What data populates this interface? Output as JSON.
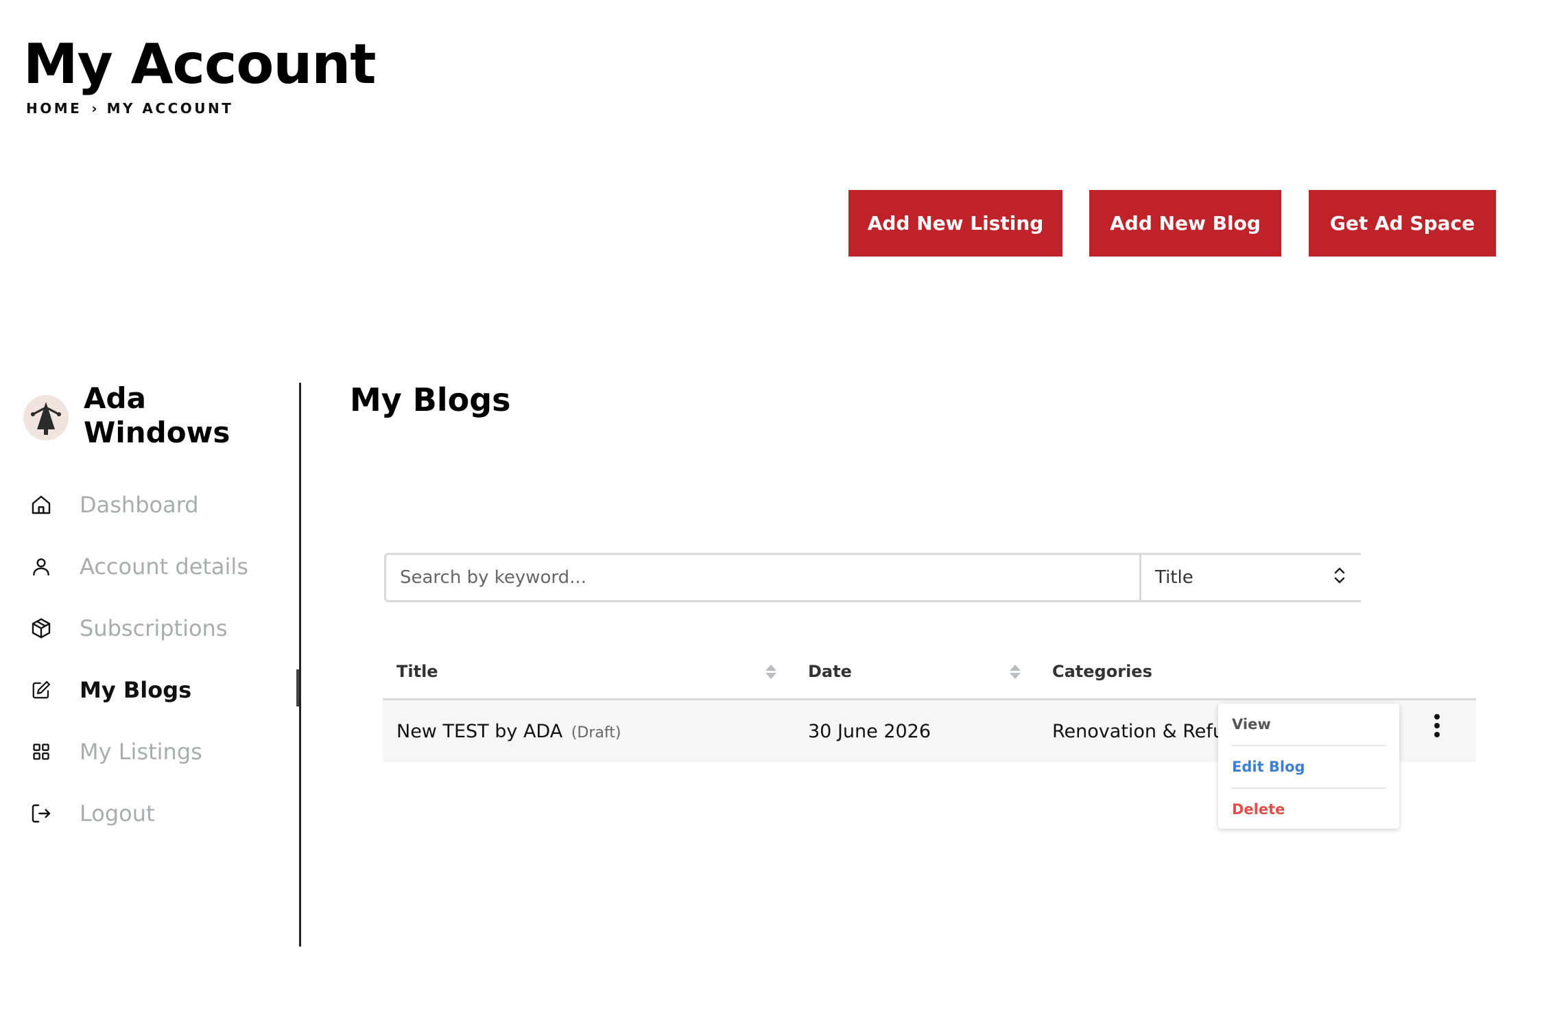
{
  "header": {
    "title": "My Account",
    "breadcrumb": {
      "home": "HOME",
      "separator": "›",
      "current": "MY ACCOUNT"
    }
  },
  "actions": {
    "add_listing": "Add New Listing",
    "add_blog": "Add New Blog",
    "get_ad_space": "Get Ad Space",
    "accent_color": "#bf2329"
  },
  "user": {
    "name": "Ada Windows"
  },
  "sidebar": {
    "items": [
      {
        "label": "Dashboard",
        "icon": "home-icon",
        "active": false
      },
      {
        "label": "Account details",
        "icon": "user-icon",
        "active": false
      },
      {
        "label": "Subscriptions",
        "icon": "box-icon",
        "active": false
      },
      {
        "label": "My Blogs",
        "icon": "edit-icon",
        "active": true
      },
      {
        "label": "My Listings",
        "icon": "grid-icon",
        "active": false
      },
      {
        "label": "Logout",
        "icon": "logout-icon",
        "active": false
      }
    ]
  },
  "main": {
    "section_title": "My Blogs",
    "search": {
      "placeholder": "Search by keyword...",
      "value": ""
    },
    "filter": {
      "selected": "Title"
    },
    "table": {
      "columns": [
        "Title",
        "Date",
        "Categories"
      ],
      "rows": [
        {
          "title": "New TEST by ADA",
          "status": "(Draft)",
          "date": "30 June 2026",
          "categories": "Renovation & Refu"
        }
      ]
    },
    "row_menu": {
      "view": "View",
      "edit": "Edit Blog",
      "delete": "Delete"
    }
  }
}
